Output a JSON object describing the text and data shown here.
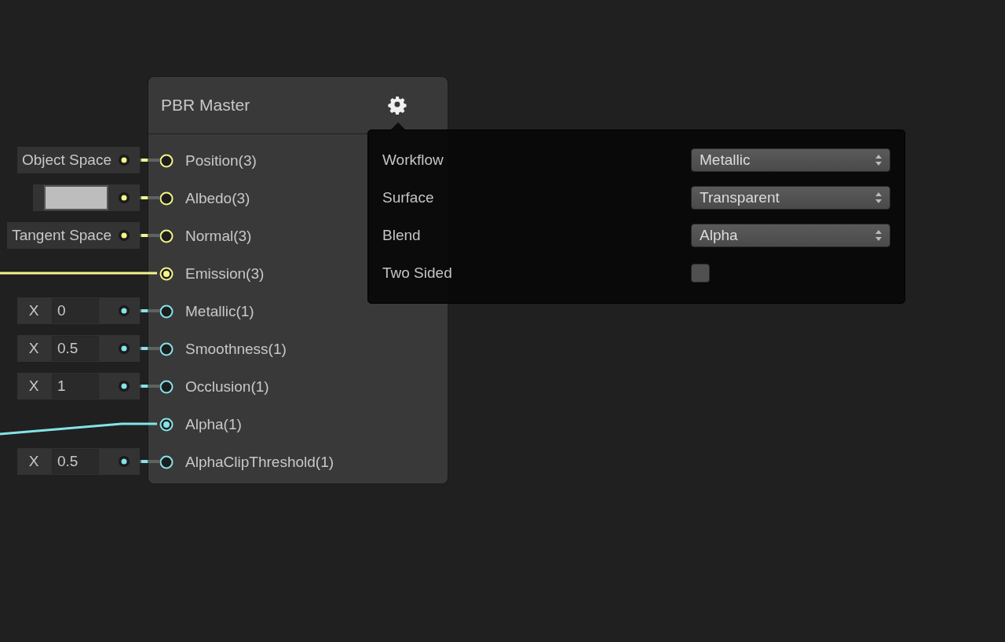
{
  "node": {
    "title": "PBR Master",
    "ports": [
      {
        "name": "Position(3)",
        "color": "#f4f48a",
        "connected": false,
        "input": {
          "kind": "label",
          "text": "Object Space"
        }
      },
      {
        "name": "Albedo(3)",
        "color": "#f4f48a",
        "connected": false,
        "input": {
          "kind": "color"
        }
      },
      {
        "name": "Normal(3)",
        "color": "#f4f48a",
        "connected": false,
        "input": {
          "kind": "label",
          "text": "Tangent Space"
        }
      },
      {
        "name": "Emission(3)",
        "color": "#f4f48a",
        "connected": true
      },
      {
        "name": "Metallic(1)",
        "color": "#84e4e7",
        "connected": false,
        "input": {
          "kind": "vector1",
          "axis": "X",
          "value": "0"
        }
      },
      {
        "name": "Smoothness(1)",
        "color": "#84e4e7",
        "connected": false,
        "input": {
          "kind": "vector1",
          "axis": "X",
          "value": "0.5"
        }
      },
      {
        "name": "Occlusion(1)",
        "color": "#84e4e7",
        "connected": false,
        "input": {
          "kind": "vector1",
          "axis": "X",
          "value": "1"
        }
      },
      {
        "name": "Alpha(1)",
        "color": "#84e4e7",
        "connected": true
      },
      {
        "name": "AlphaClipThreshold(1)",
        "color": "#84e4e7",
        "connected": false,
        "input": {
          "kind": "vector1",
          "axis": "X",
          "value": "0.5"
        }
      }
    ]
  },
  "settings": [
    {
      "kind": "dropdown",
      "label": "Workflow",
      "value": "Metallic"
    },
    {
      "kind": "dropdown",
      "label": "Surface",
      "value": "Transparent"
    },
    {
      "kind": "dropdown",
      "label": "Blend",
      "value": "Alpha"
    },
    {
      "kind": "checkbox",
      "label": "Two Sided",
      "checked": false
    }
  ]
}
